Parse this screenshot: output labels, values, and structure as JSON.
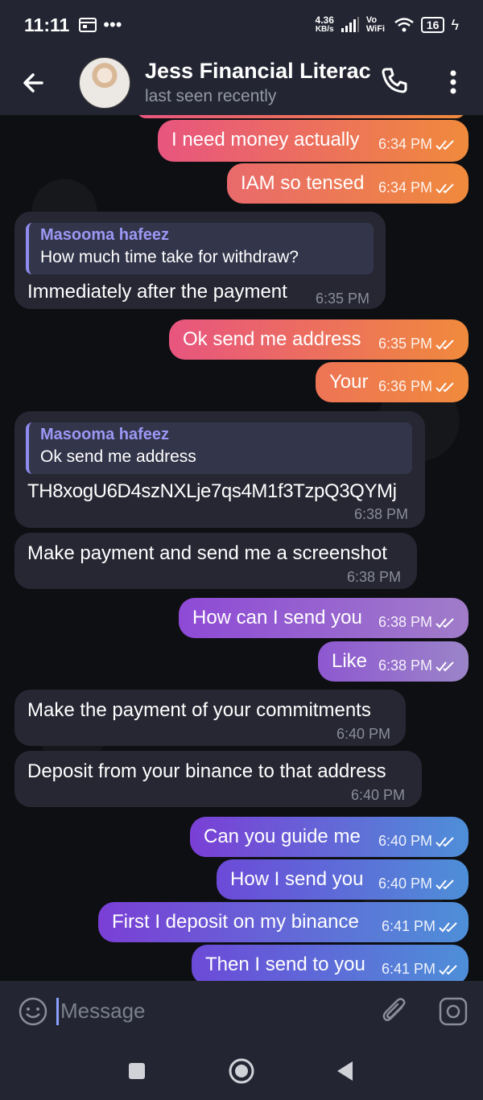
{
  "status": {
    "time": "11:11",
    "net_speed": "4.36",
    "net_unit": "KB/s",
    "vowifi": "Vo WiFi",
    "battery": "16"
  },
  "header": {
    "title": "Jess Financial Literacy",
    "subtitle": "last seen recently"
  },
  "messages": [
    {
      "text": "I need money actually",
      "time": "6:34 PM"
    },
    {
      "text": "IAM so tensed",
      "time": "6:34 PM"
    },
    {
      "reply_name": "Masooma hafeez",
      "reply_text": "How much time take for withdraw?",
      "text": "Immediately after the payment",
      "time": "6:35 PM"
    },
    {
      "text": "Ok send me address",
      "time": "6:35 PM"
    },
    {
      "text": "Your",
      "time": "6:36 PM"
    },
    {
      "reply_name": "Masooma hafeez",
      "reply_text": "Ok send me address",
      "text": "TH8xogU6D4szNXLje7qs4M1f3TzpQ3QYMj",
      "time": "6:38 PM"
    },
    {
      "text": "Make payment and send me a screenshot",
      "time": "6:38 PM"
    },
    {
      "text": "How can I send you",
      "time": "6:38 PM"
    },
    {
      "text": "Like",
      "time": "6:38 PM"
    },
    {
      "text": "Make the payment of your commitments",
      "time": "6:40 PM"
    },
    {
      "text": "Deposit from your binance to that address",
      "time": "6:40 PM"
    },
    {
      "text": "Can you guide me",
      "time": "6:40 PM"
    },
    {
      "text": "How I send you",
      "time": "6:40 PM"
    },
    {
      "text": "First I deposit on my binance",
      "time": "6:41 PM"
    },
    {
      "text": "Then I send to you",
      "time": "6:41 PM"
    }
  ],
  "input": {
    "placeholder": "Message"
  },
  "colors": {
    "bar_bg": "#232532",
    "incoming_bubble": "#262733",
    "outgoing_warm_start": "#e8557f",
    "outgoing_warm_end": "#f08a3c",
    "outgoing_cool_start": "#8e4ad6",
    "outgoing_cool_end": "#4e8fd8",
    "quote_accent": "#9b98f5"
  },
  "icons": [
    "back-arrow-icon",
    "phone-icon",
    "more-vert-icon",
    "emoji-icon",
    "attach-icon",
    "camera-icon",
    "double-check-icon",
    "recents-icon",
    "home-icon",
    "back-nav-icon"
  ]
}
